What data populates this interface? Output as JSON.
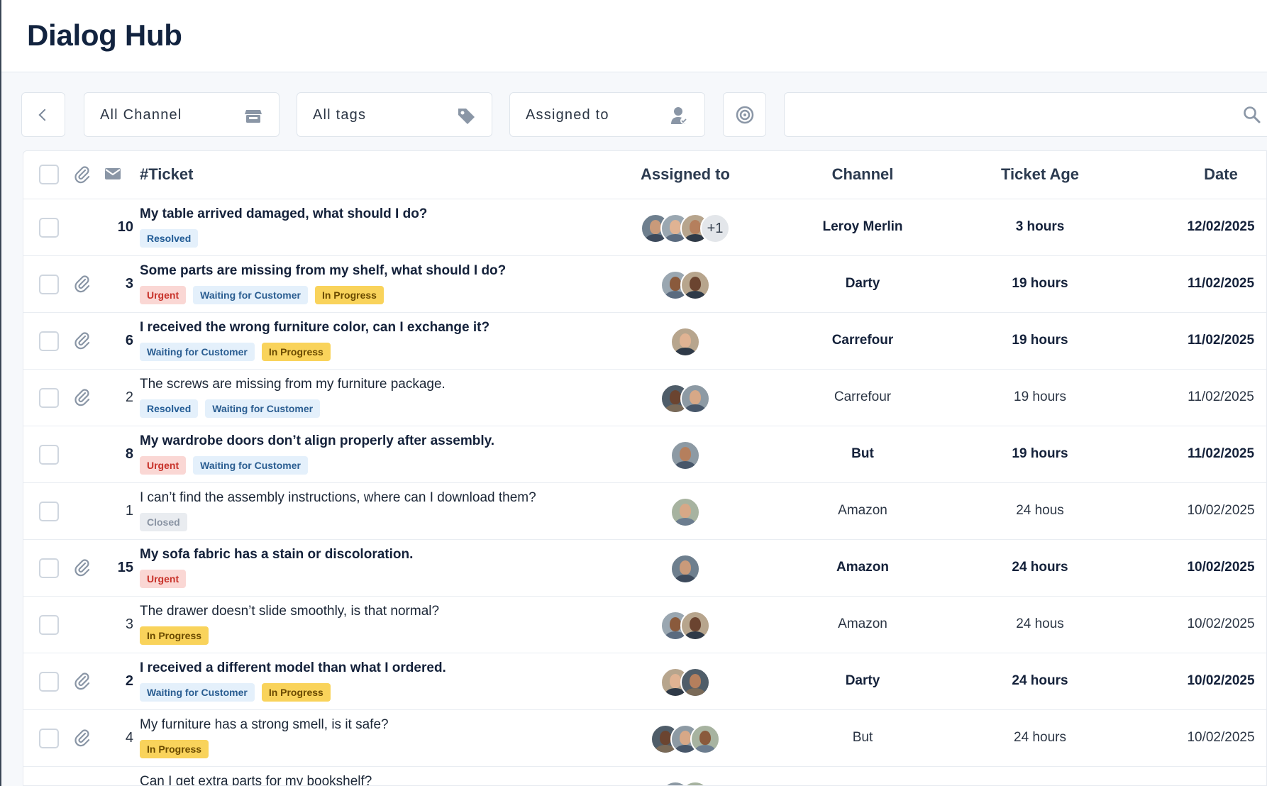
{
  "header": {
    "title": "Dialog Hub"
  },
  "toolbar": {
    "back_icon": "chevron-left-icon",
    "filters": [
      {
        "label": "All Channel",
        "icon": "store-icon"
      },
      {
        "label": "All tags",
        "icon": "tag-icon"
      },
      {
        "label": "Assigned to",
        "icon": "user-check-icon"
      }
    ],
    "target_icon": "target-icon",
    "search": {
      "value": "",
      "placeholder": "",
      "icon": "search-icon"
    }
  },
  "table": {
    "columns": {
      "attachment_icon": "paperclip-icon",
      "message_icon": "envelope-icon",
      "ticket": "#Ticket",
      "assigned": "Assigned to",
      "channel": "Channel",
      "age": "Ticket Age",
      "date": "Date"
    },
    "rows": [
      {
        "id": "10",
        "attachment": false,
        "unread": true,
        "subject": "My table arrived damaged, what should I do?",
        "tags": [
          "Resolved"
        ],
        "avatars": 3,
        "extra": "+1",
        "channel": "Leroy Merlin",
        "age": "3 hours",
        "date": "12/02/2025"
      },
      {
        "id": "3",
        "attachment": true,
        "unread": true,
        "subject": "Some parts are missing from my shelf, what should I do?",
        "tags": [
          "Urgent",
          "Waiting for Customer",
          "In Progress"
        ],
        "avatars": 2,
        "extra": "",
        "channel": "Darty",
        "age": "19 hours",
        "date": "11/02/2025"
      },
      {
        "id": "6",
        "attachment": true,
        "unread": true,
        "subject": "I received the wrong furniture color, can I exchange it?",
        "tags": [
          "Waiting for Customer",
          "In Progress"
        ],
        "avatars": 1,
        "extra": "",
        "channel": "Carrefour",
        "age": "19 hours",
        "date": "11/02/2025"
      },
      {
        "id": "2",
        "attachment": true,
        "unread": false,
        "subject": "The screws are missing from my furniture package.",
        "tags": [
          "Resolved",
          "Waiting for Customer"
        ],
        "avatars": 2,
        "extra": "",
        "channel": "Carrefour",
        "age": "19 hours",
        "date": "11/02/2025"
      },
      {
        "id": "8",
        "attachment": false,
        "unread": true,
        "subject": "My wardrobe doors don’t align properly after assembly.",
        "tags": [
          "Urgent",
          "Waiting for Customer"
        ],
        "avatars": 1,
        "extra": "",
        "channel": "But",
        "age": "19 hours",
        "date": "11/02/2025"
      },
      {
        "id": "1",
        "attachment": false,
        "unread": false,
        "subject": "I can’t find the assembly instructions, where can I download them?",
        "tags": [
          "Closed"
        ],
        "avatars": 1,
        "extra": "",
        "channel": "Amazon",
        "age": "24 hous",
        "date": "10/02/2025"
      },
      {
        "id": "15",
        "attachment": true,
        "unread": true,
        "subject": "My sofa fabric has a stain or discoloration.",
        "tags": [
          "Urgent"
        ],
        "avatars": 1,
        "extra": "",
        "channel": "Amazon",
        "age": "24 hours",
        "date": "10/02/2025"
      },
      {
        "id": "3",
        "attachment": false,
        "unread": false,
        "subject": "The drawer doesn’t slide smoothly, is that normal?",
        "tags": [
          "In Progress"
        ],
        "avatars": 2,
        "extra": "",
        "channel": "Amazon",
        "age": "24 hous",
        "date": "10/02/2025"
      },
      {
        "id": "2",
        "attachment": true,
        "unread": true,
        "subject": "I received a different model than what I ordered.",
        "tags": [
          "Waiting for Customer",
          "In Progress"
        ],
        "avatars": 2,
        "extra": "",
        "channel": "Darty",
        "age": "24 hours",
        "date": "10/02/2025"
      },
      {
        "id": "4",
        "attachment": true,
        "unread": false,
        "subject": "My furniture has a strong smell, is it safe?",
        "tags": [
          "In Progress"
        ],
        "avatars": 3,
        "extra": "",
        "channel": "But",
        "age": "24 hours",
        "date": "10/02/2025"
      },
      {
        "id": "",
        "attachment": false,
        "unread": false,
        "subject": "Can I get extra parts for my bookshelf?",
        "tags": [],
        "avatars": 2,
        "extra": "",
        "channel": "",
        "age": "",
        "date": ""
      }
    ]
  },
  "colors": {
    "title": "#12233f",
    "urgent_bg": "#fad7d4",
    "urgent_text": "#c8322a",
    "progress_bg": "#f9d35b",
    "waiting_bg": "#e4f0fb",
    "closed_bg": "#e9ecf0"
  }
}
